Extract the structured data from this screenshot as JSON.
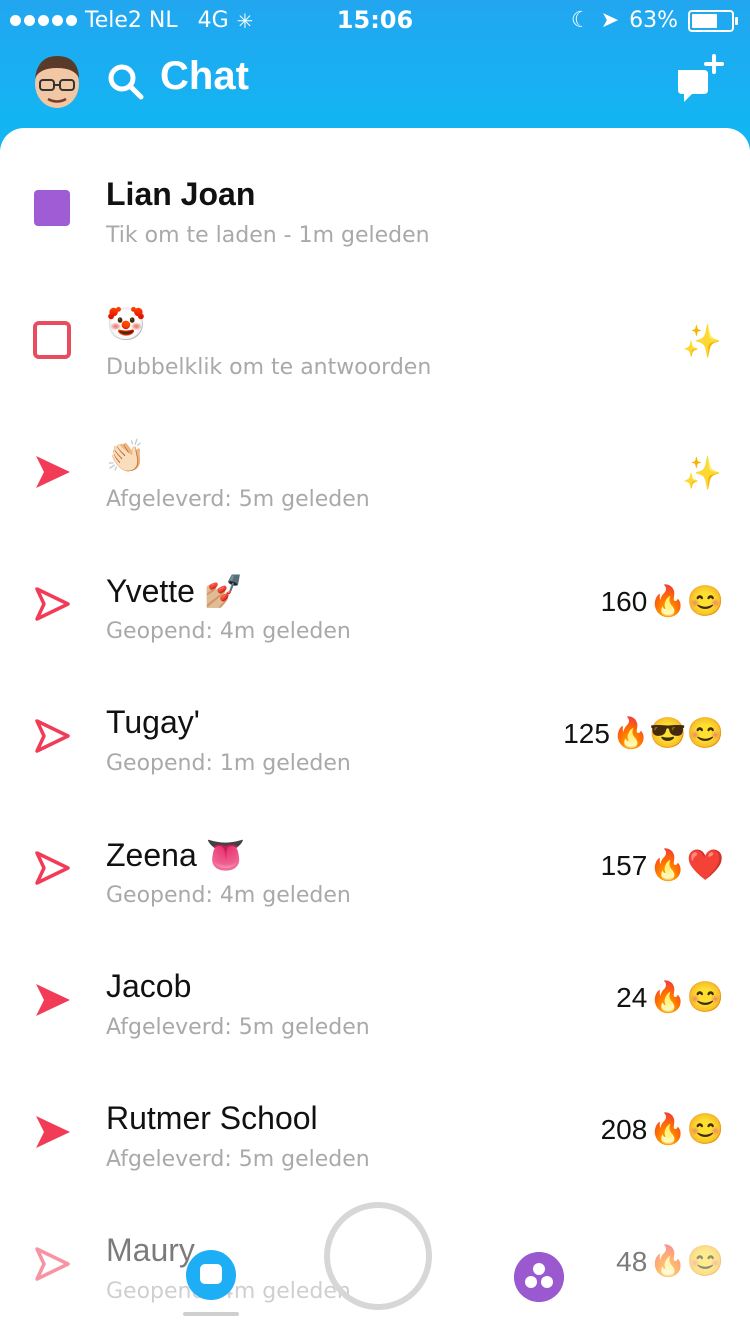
{
  "status_bar": {
    "carrier": "Tele2 NL",
    "network": "4G",
    "time": "15:06",
    "battery": "63%"
  },
  "header": {
    "title": "Chat",
    "search_icon": "search-icon",
    "new_chat_icon": "new-chat-icon"
  },
  "chats": [
    {
      "name": "Lian Joan",
      "subtitle": "Tik om te laden - 1m geleden",
      "icon": "filled-square",
      "icon_color": "#a05cd5",
      "bold": true
    },
    {
      "name": "🤡",
      "subtitle": "Dubbelklik om te antwoorden",
      "icon": "outline-square",
      "icon_color": "#e84c5e",
      "right": "✨"
    },
    {
      "name": "👏🏻",
      "subtitle": "Afgeleverd: 5m geleden",
      "icon": "filled-arrow",
      "icon_color": "#f23c57",
      "right": "✨"
    },
    {
      "name": "Yvette 💅🏼",
      "subtitle": "Geopend: 4m geleden",
      "icon": "outline-arrow",
      "icon_color": "#f23c57",
      "streak": "160",
      "emojis": "🔥😊"
    },
    {
      "name": "Tugay'",
      "subtitle": "Geopend: 1m geleden",
      "icon": "outline-arrow",
      "icon_color": "#f23c57",
      "streak": "125",
      "emojis": "🔥😎😊"
    },
    {
      "name": "Zeena 👅",
      "subtitle": "Geopend: 4m geleden",
      "icon": "outline-arrow",
      "icon_color": "#f23c57",
      "streak": "157",
      "emojis": "🔥❤️"
    },
    {
      "name": "Jacob",
      "subtitle": "Afgeleverd: 5m geleden",
      "icon": "filled-arrow",
      "icon_color": "#f23c57",
      "streak": "24",
      "emojis": "🔥😊"
    },
    {
      "name": "Rutmer School",
      "subtitle": "Afgeleverd: 5m geleden",
      "icon": "filled-arrow",
      "icon_color": "#f23c57",
      "streak": "208",
      "emojis": "🔥😊"
    },
    {
      "name": "Maury",
      "subtitle": "Geopend: 4m geleden",
      "icon": "outline-arrow",
      "icon_color": "#f23c57",
      "streak": "48",
      "emojis": "🔥😊"
    }
  ],
  "bottom_nav": {
    "chat_icon": "chat-bubble-icon",
    "capture_icon": "capture-button",
    "discover_icon": "discover-icon"
  }
}
